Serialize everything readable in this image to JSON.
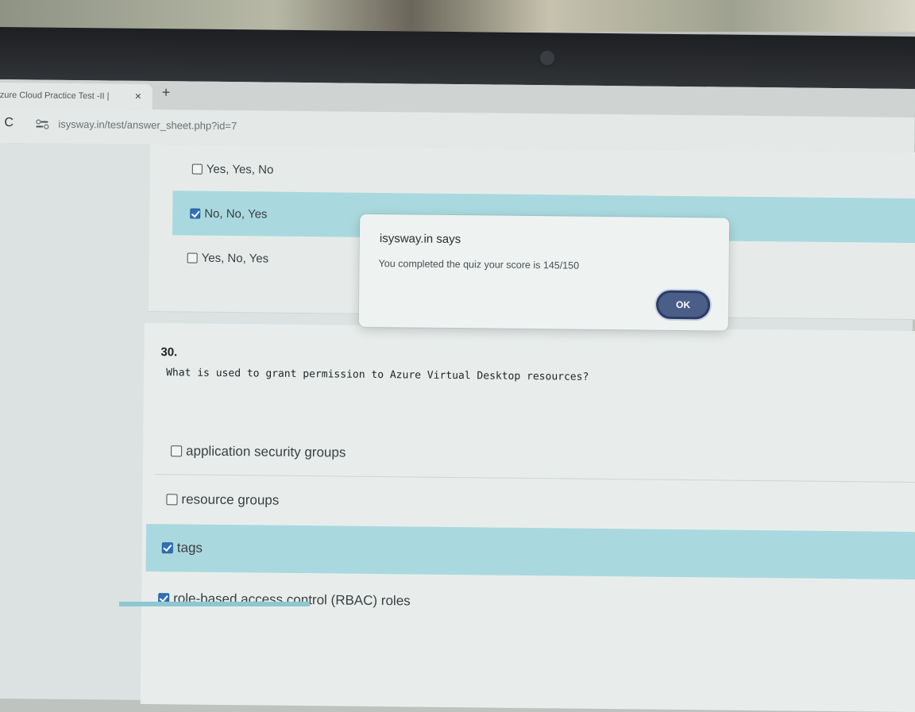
{
  "browser": {
    "tab_title": "zure Cloud Practice Test -II | ",
    "tab_close": "×",
    "new_tab": "+",
    "reload": "C",
    "url": "isysway.in/test/answer_sheet.php?id=7"
  },
  "prev_question": {
    "options": [
      {
        "label": "Yes, Yes, No",
        "checked": false
      },
      {
        "label": "No, No, Yes",
        "checked": true
      },
      {
        "label": "Yes, No, Yes",
        "checked": false
      }
    ]
  },
  "question": {
    "number": "30.",
    "text": "What is used to grant permission to Azure Virtual Desktop resources?",
    "options": [
      {
        "label": "application security groups",
        "checked": false
      },
      {
        "label": "resource groups",
        "checked": false
      },
      {
        "label": "tags",
        "checked": true
      },
      {
        "label": "role-based access control (RBAC) roles",
        "checked": true
      }
    ]
  },
  "dialog": {
    "title": "isysway.in says",
    "message": "You completed the quiz your score is 145/150",
    "ok_label": "OK"
  },
  "colors": {
    "selected_row": "#a9d9de",
    "checkbox_checked": "#2f6fb8",
    "ok_button": "#4a5e88"
  }
}
